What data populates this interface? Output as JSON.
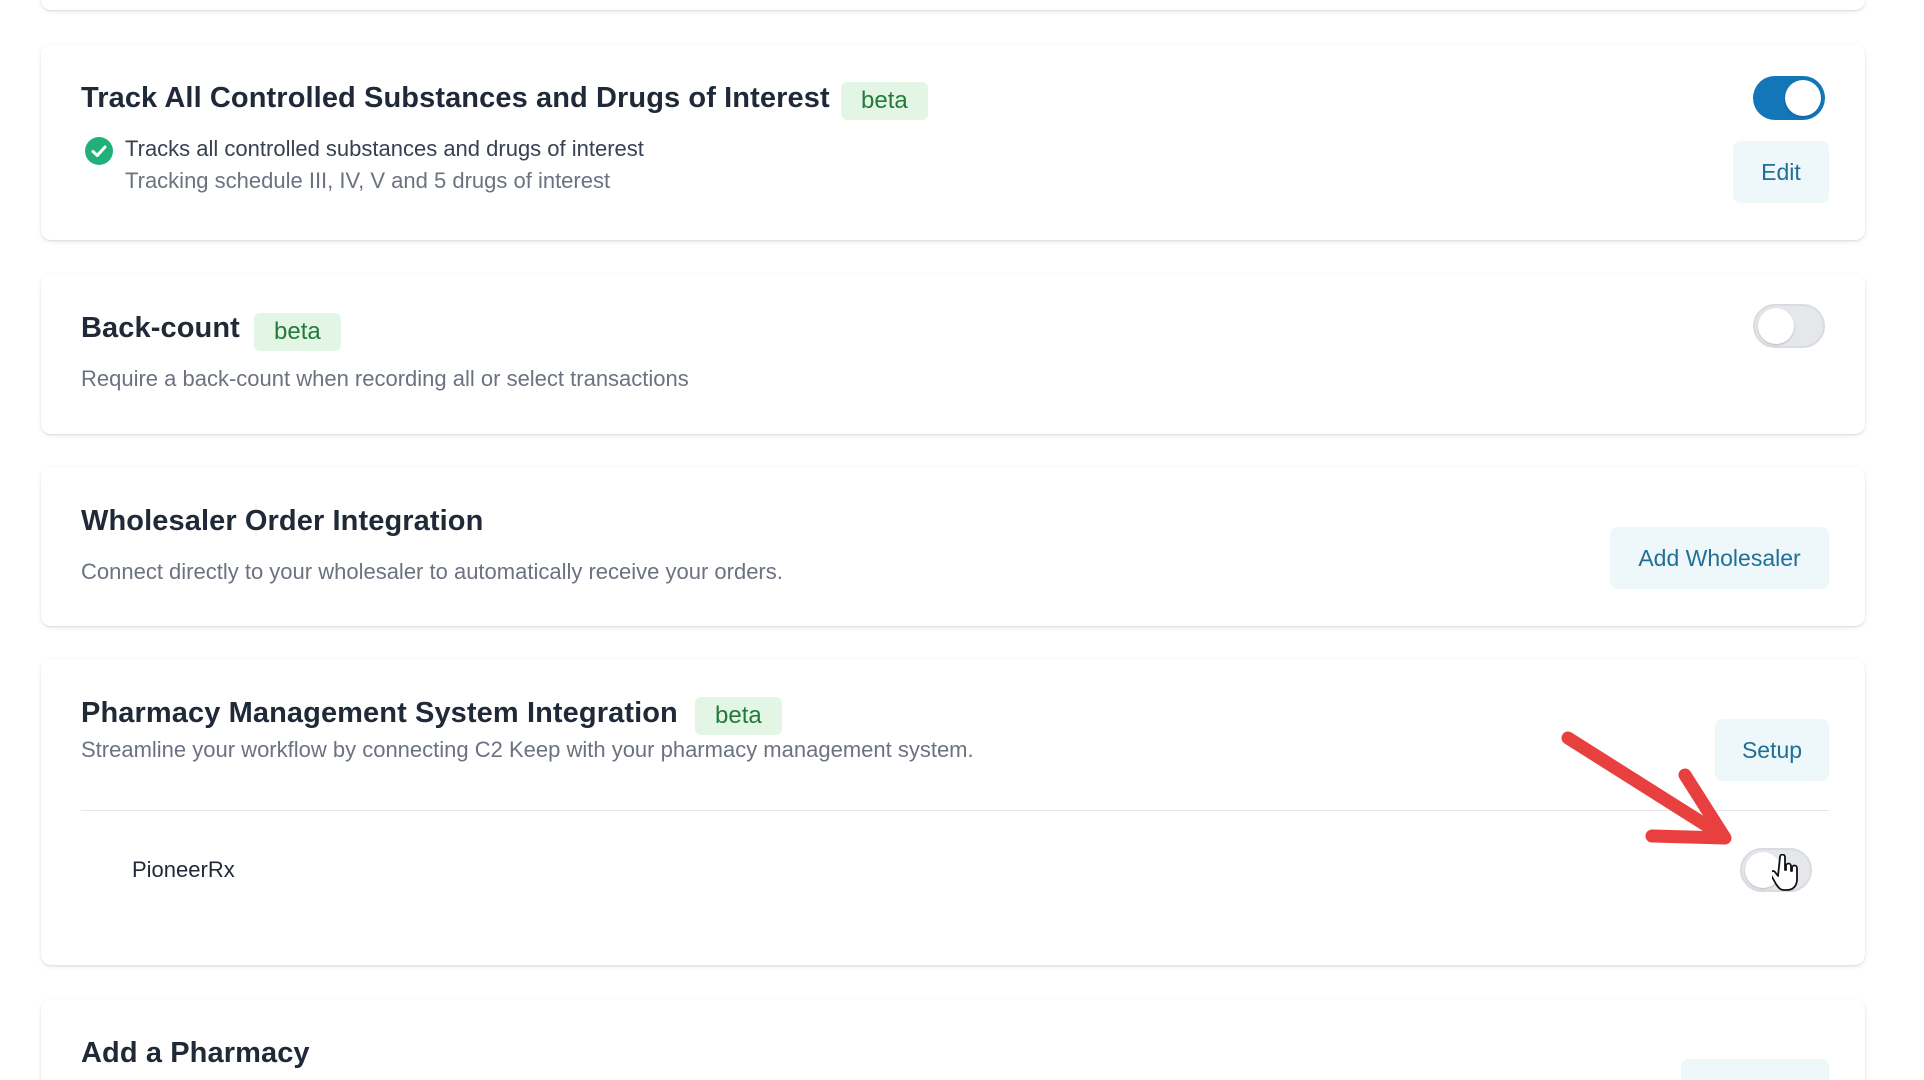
{
  "cards": {
    "track": {
      "title": "Track All Controlled Substances and Drugs of Interest",
      "badge": "beta",
      "status_text": "Tracks all controlled substances and drugs of interest",
      "status_detail": "Tracking schedule III, IV, V and 5 drugs of interest",
      "edit_label": "Edit",
      "toggle_on": true
    },
    "backcount": {
      "title": "Back-count",
      "badge": "beta",
      "description": "Require a back-count when recording all or select transactions",
      "toggle_on": false
    },
    "wholesaler": {
      "title": "Wholesaler Order Integration",
      "description": "Connect directly to your wholesaler to automatically receive your orders.",
      "button_label": "Add Wholesaler"
    },
    "pms": {
      "title": "Pharmacy Management System Integration",
      "badge": "beta",
      "description": "Streamline your workflow by connecting C2 Keep with your pharmacy management system.",
      "setup_label": "Setup",
      "integrations": [
        {
          "name": "PioneerRx",
          "toggle_on": false
        }
      ]
    },
    "add_pharmacy": {
      "title": "Add a Pharmacy"
    }
  },
  "colors": {
    "toggle_on": "#1276b9",
    "badge_bg": "#e3f6e6",
    "badge_text": "#237a3b",
    "button_bg": "#eef7fa",
    "button_text": "#1f6f96",
    "annotation_arrow": "#e8403f",
    "check": "#22b07a"
  },
  "icons": {
    "status": "check-circle-icon",
    "annotation": "red-arrow-annotation",
    "pointer": "hand-cursor-icon"
  }
}
